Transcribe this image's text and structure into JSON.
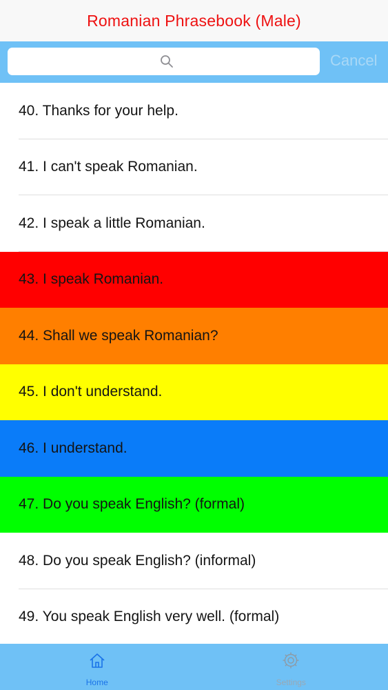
{
  "app": {
    "title": "Romanian Phrasebook (Male)"
  },
  "search": {
    "placeholder": "",
    "cancel_label": "Cancel",
    "icon": "search-icon"
  },
  "phrases": [
    {
      "text": "40. Thanks for your help.",
      "color": "#ffffff"
    },
    {
      "text": "41. I can't speak Romanian.",
      "color": "#ffffff"
    },
    {
      "text": "42. I speak a little Romanian.",
      "color": "#ffffff"
    },
    {
      "text": "43. I speak Romanian.",
      "color": "#ff0000"
    },
    {
      "text": "44. Shall we speak Romanian?",
      "color": "#ff7f00"
    },
    {
      "text": "45. I don't understand.",
      "color": "#ffff00"
    },
    {
      "text": "46. I understand.",
      "color": "#0a7cf9"
    },
    {
      "text": "47. Do you speak English? (formal)",
      "color": "#00ff00"
    },
    {
      "text": "48. Do you speak English? (informal)",
      "color": "#ffffff"
    },
    {
      "text": "49. You speak English very well. (formal)",
      "color": "#ffffff"
    },
    {
      "text": "",
      "color": "#ffffff"
    }
  ],
  "tabs": [
    {
      "label": "Home",
      "icon": "home-icon",
      "selected": true
    },
    {
      "label": "Settings",
      "icon": "gear-icon",
      "selected": false
    }
  ],
  "colors": {
    "title": "#ee1111",
    "bar_blue": "#6fc1f6",
    "tab_active": "#1a73e8",
    "tab_inactive": "#9aa8b3"
  }
}
